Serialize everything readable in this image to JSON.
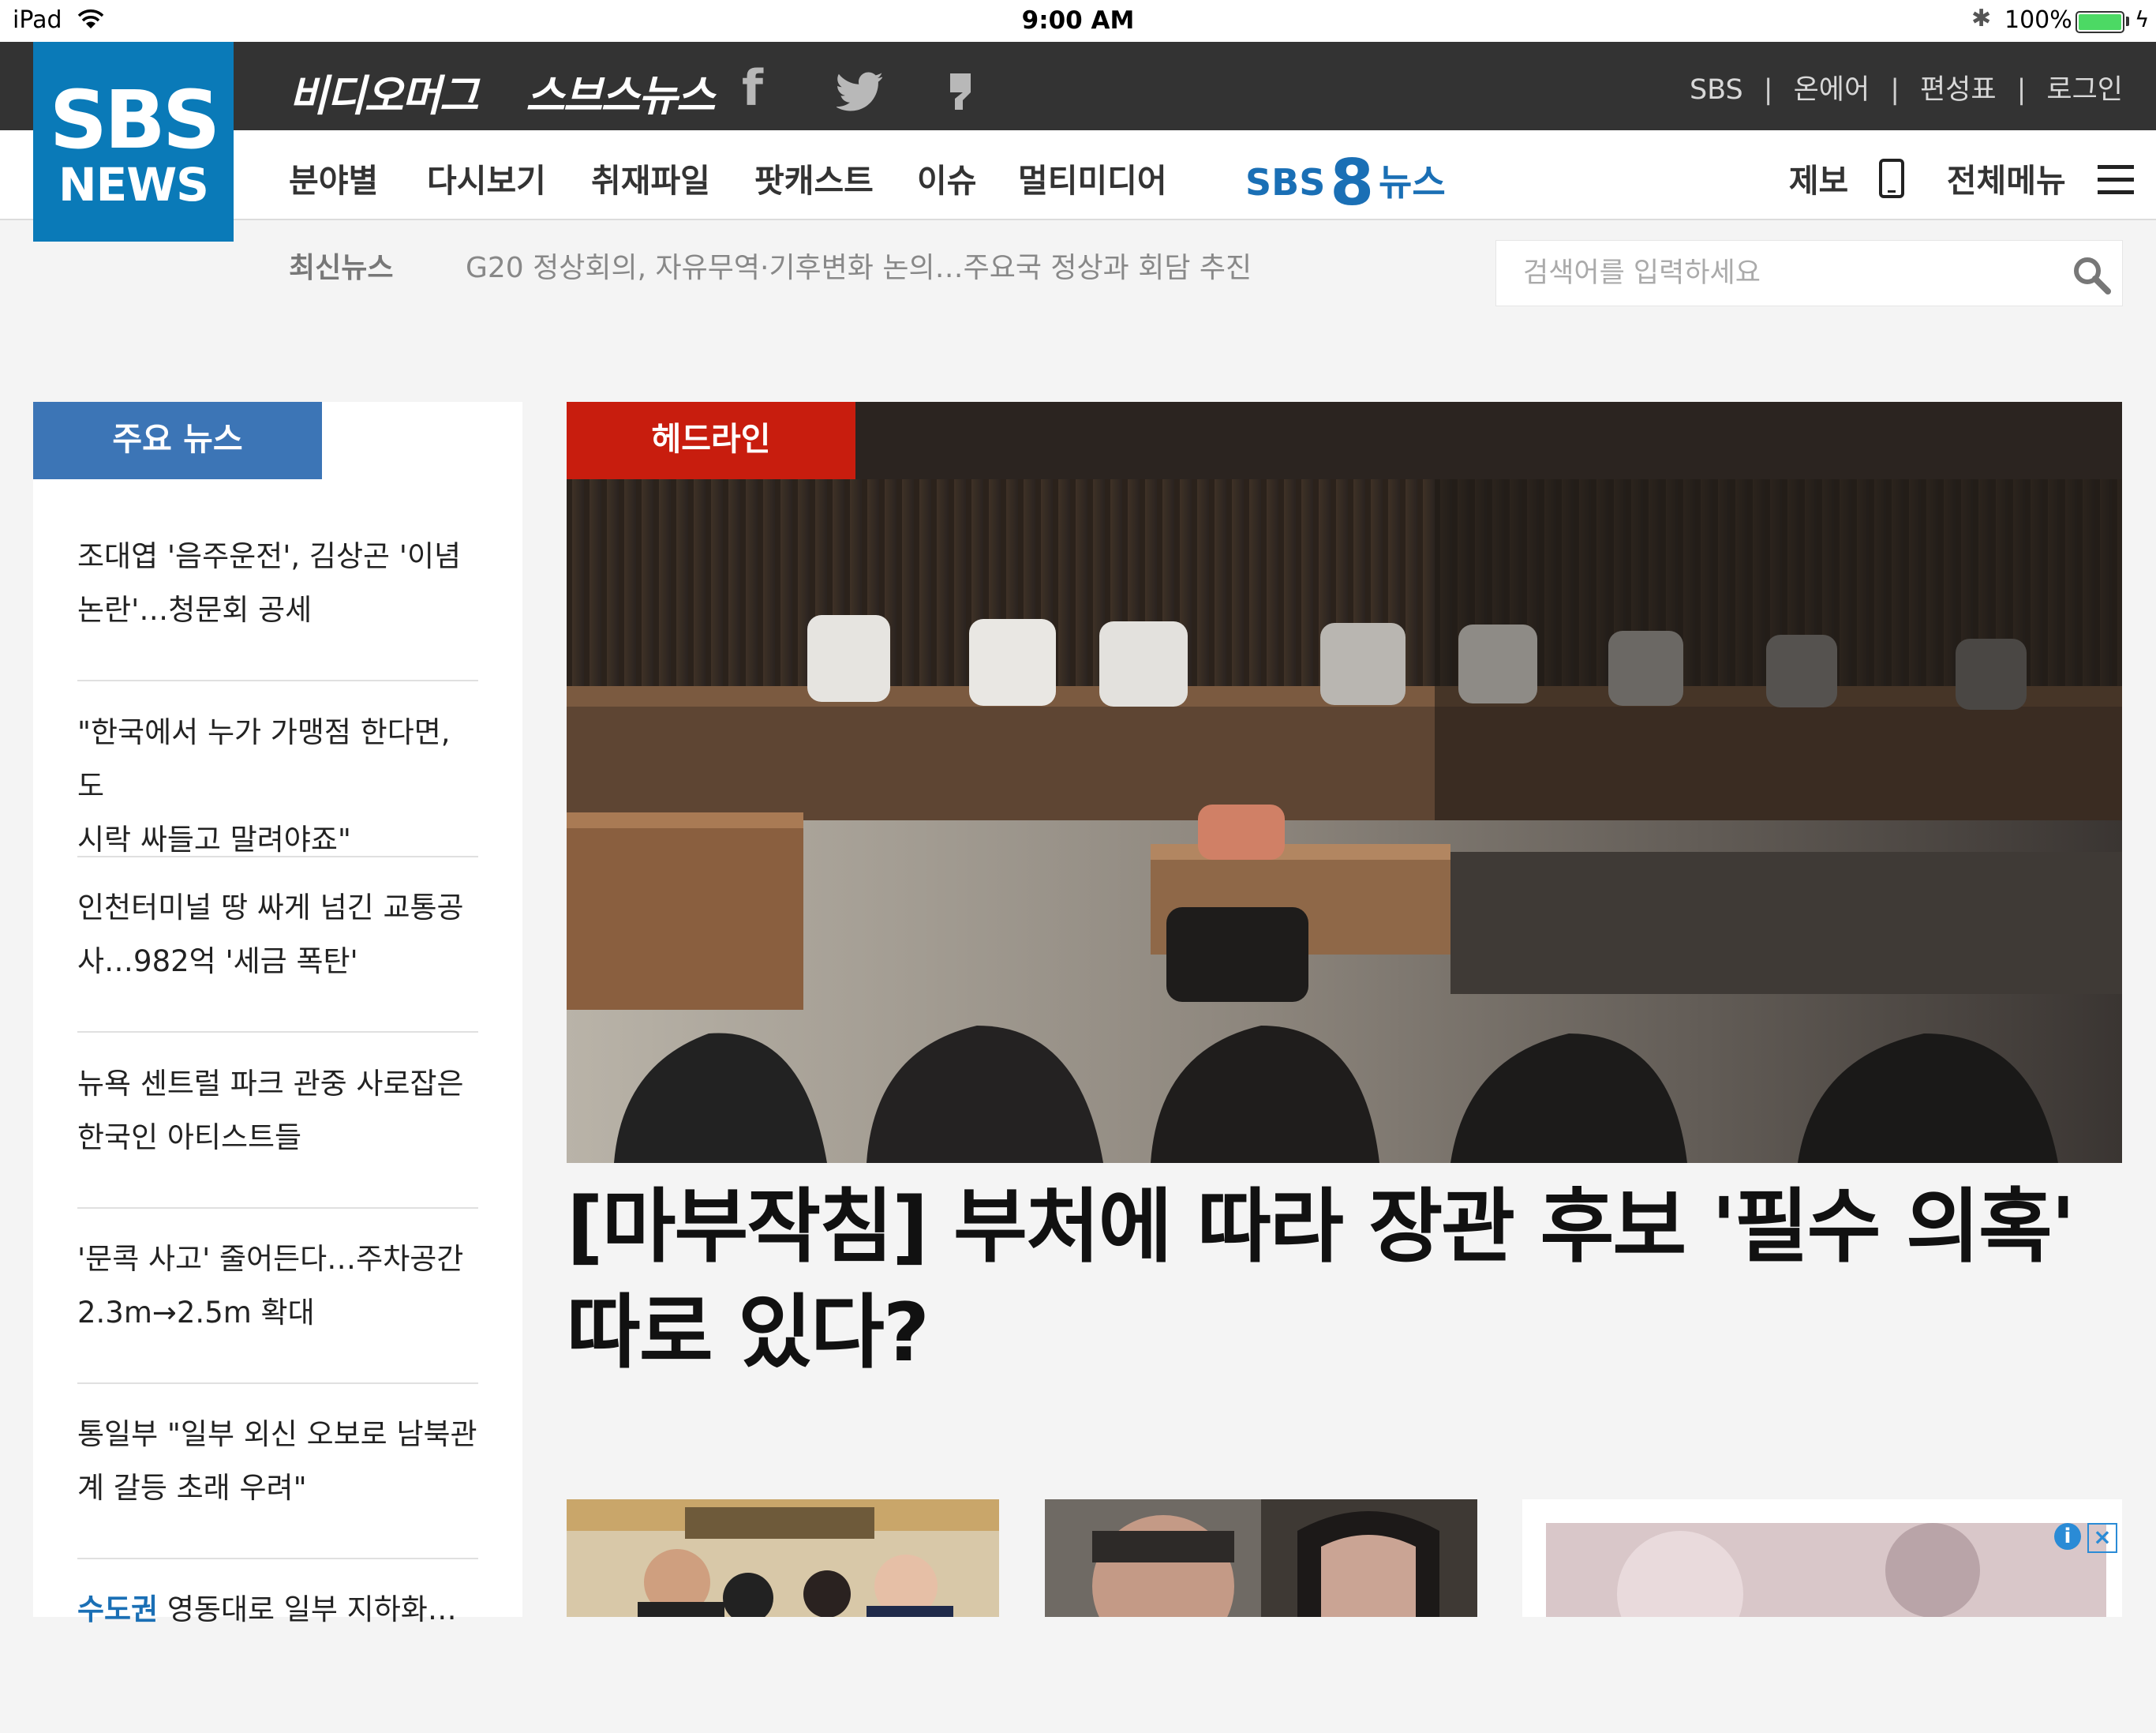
{
  "status_bar": {
    "device": "iPad",
    "time": "9:00 AM",
    "battery": "100%"
  },
  "top_bar": {
    "links": [
      "비디오머그",
      "스브스뉴스"
    ],
    "social_icons": [
      "facebook-icon",
      "twitter-icon",
      "kakao-story-icon"
    ],
    "right_links": [
      "SBS",
      "온에어",
      "편성표",
      "로그인"
    ]
  },
  "logo": {
    "line1": "SBS",
    "line2": "NEWS"
  },
  "nav": {
    "items": [
      "분야별",
      "다시보기",
      "취재파일",
      "팟캐스트",
      "이슈",
      "멀티미디어"
    ],
    "sbs8": {
      "left": "SBS",
      "num": "8",
      "right": "뉴스"
    },
    "report": "제보",
    "all_menu": "전체메뉴"
  },
  "ticker": {
    "label": "최신뉴스",
    "text": "G20 정상회의, 자유무역·기후변화 논의…주요국 정상과 회담 추진"
  },
  "search": {
    "placeholder": "검색어를 입력하세요"
  },
  "top_news": {
    "label": "주요 뉴스",
    "items": [
      {
        "line1": "조대엽 '음주운전', 김상곤 '이념",
        "line2": "논란'…청문회 공세"
      },
      {
        "line1": "\"한국에서 누가 가맹점 한다면, 도",
        "line2": "시락 싸들고 말려야죠\""
      },
      {
        "line1": "인천터미널 땅 싸게 넘긴 교통공",
        "line2": "사…982억 '세금 폭탄'"
      },
      {
        "line1": "뉴욕 센트럴 파크 관중 사로잡은",
        "line2": "한국인 아티스트들"
      },
      {
        "line1": "'문콕 사고' 줄어든다…주차공간",
        "line2": "2.3m→2.5m 확대"
      },
      {
        "line1": "통일부 \"일부 외신 오보로 남북관",
        "line2": "계 갈등 초래 우려\""
      },
      {
        "highlight": "수도권",
        "line1": "영동대로 일부 지하화…"
      }
    ]
  },
  "headline": {
    "label": "헤드라인",
    "title": "[마부작침] 부처에 따라 장관 후보 '필수 의혹' 따로 있다?"
  },
  "colors": {
    "top_bar": "#333333",
    "logo_bg": "#0a7ab8",
    "section_blue": "#3c75b6",
    "headline_red": "#c81d0e",
    "sbs8_blue": "#1a6fb5"
  }
}
